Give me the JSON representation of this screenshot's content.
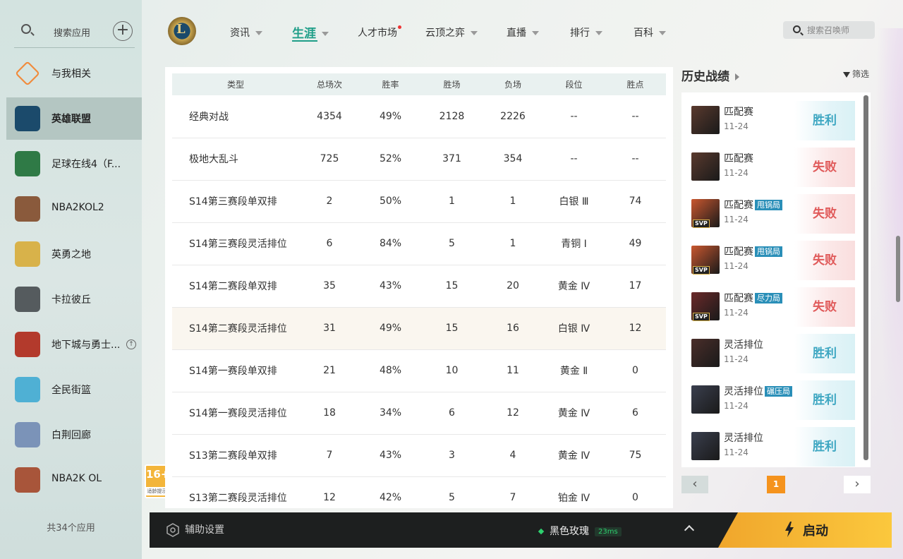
{
  "sidebar": {
    "search_label": "搜索应用",
    "add_label": "+",
    "apps": [
      {
        "name": "与我相关",
        "icon": "related-icon",
        "color": "#f18a3a"
      },
      {
        "name": "英雄联盟",
        "icon": "lol-icon",
        "color": "#1b4a6b"
      },
      {
        "name": "足球在线4（F...",
        "icon": "fifa-icon",
        "color": "#2f7a46"
      },
      {
        "name": "NBA2KOL2",
        "icon": "basketball-icon",
        "color": "#8a5a3c"
      },
      {
        "name": "英勇之地",
        "icon": "hero-land-icon",
        "color": "#d8b24a"
      },
      {
        "name": "卡拉彼丘",
        "icon": "strinova-icon",
        "color": "#555b5e"
      },
      {
        "name": "地下城与勇士...",
        "icon": "dnf-icon",
        "color": "#b33a2c"
      },
      {
        "name": "全民街篮",
        "icon": "street-basketball-icon",
        "color": "#4fb0d4"
      },
      {
        "name": "白荆回廊",
        "icon": "corridor-icon",
        "color": "#7b93b8"
      },
      {
        "name": "NBA2K OL",
        "icon": "nba2kol-icon",
        "color": "#a8553a"
      }
    ],
    "count": "共34个应用",
    "age_rating": "16+",
    "age_note": "适龄提示"
  },
  "nav": {
    "logo_letter": "L",
    "items": [
      "资讯",
      "生涯",
      "人才市场",
      "云顶之弈",
      "直播",
      "排行",
      "百科"
    ],
    "search_placeholder": "搜索召唤师"
  },
  "table": {
    "headers": [
      "类型",
      "总场次",
      "胜率",
      "胜场",
      "负场",
      "段位",
      "胜点"
    ],
    "rows": [
      [
        "经典对战",
        "4354",
        "49%",
        "2128",
        "2226",
        "--",
        "--"
      ],
      [
        "极地大乱斗",
        "725",
        "52%",
        "371",
        "354",
        "--",
        "--"
      ],
      [
        "S14第三赛段单双排",
        "2",
        "50%",
        "1",
        "1",
        "白银 Ⅲ",
        "74"
      ],
      [
        "S14第三赛段灵活排位",
        "6",
        "84%",
        "5",
        "1",
        "青铜 Ⅰ",
        "49"
      ],
      [
        "S14第二赛段单双排",
        "35",
        "43%",
        "15",
        "20",
        "黄金 Ⅳ",
        "17"
      ],
      [
        "S14第二赛段灵活排位",
        "31",
        "49%",
        "15",
        "16",
        "白银 Ⅳ",
        "12"
      ],
      [
        "S14第一赛段单双排",
        "21",
        "48%",
        "10",
        "11",
        "黄金 Ⅱ",
        "0"
      ],
      [
        "S14第一赛段灵活排位",
        "18",
        "34%",
        "6",
        "12",
        "黄金 Ⅳ",
        "6"
      ],
      [
        "S13第二赛段单双排",
        "7",
        "43%",
        "3",
        "4",
        "黄金 Ⅳ",
        "75"
      ],
      [
        "S13第二赛段灵活排位",
        "12",
        "42%",
        "5",
        "7",
        "铂金 Ⅳ",
        "0"
      ]
    ]
  },
  "history": {
    "title": "历史战绩",
    "filter_label": "筛选",
    "matches": [
      {
        "mode": "匹配赛",
        "tag": "",
        "date": "11-24",
        "result": "胜利",
        "outcome": "win",
        "svp": "",
        "champ_color": "#5a3a2e"
      },
      {
        "mode": "匹配赛",
        "tag": "",
        "date": "11-24",
        "result": "失败",
        "outcome": "loss",
        "svp": "",
        "champ_color": "#5a3a2e"
      },
      {
        "mode": "匹配赛",
        "tag": "甩锅局",
        "date": "11-24",
        "result": "失败",
        "outcome": "loss",
        "svp": "SVP",
        "champ_color": "#c9572f"
      },
      {
        "mode": "匹配赛",
        "tag": "甩锅局",
        "date": "11-24",
        "result": "失败",
        "outcome": "loss",
        "svp": "SVP",
        "champ_color": "#c9572f"
      },
      {
        "mode": "匹配赛",
        "tag": "尽力局",
        "date": "11-24",
        "result": "失败",
        "outcome": "loss",
        "svp": "SVP",
        "champ_color": "#6b2a2a"
      },
      {
        "mode": "灵活排位",
        "tag": "",
        "date": "11-24",
        "result": "胜利",
        "outcome": "win",
        "svp": "",
        "champ_color": "#4a2e2a"
      },
      {
        "mode": "灵活排位",
        "tag": "碾压局",
        "date": "11-24",
        "result": "胜利",
        "outcome": "win",
        "svp": "",
        "champ_color": "#3a3f4e"
      },
      {
        "mode": "灵活排位",
        "tag": "",
        "date": "11-24",
        "result": "胜利",
        "outcome": "win",
        "svp": "",
        "champ_color": "#3a3f4e"
      }
    ],
    "page": "1",
    "prev": "‹",
    "next": "›"
  },
  "bottom": {
    "assist_label": "辅助设置",
    "server": "黑色玫瑰",
    "ping": "23ms",
    "launch_label": "启动"
  },
  "colors": {
    "accent": "#1e9e88",
    "win": "#3ea7c2",
    "loss": "#e05a5a",
    "launch": "#f5b230"
  }
}
